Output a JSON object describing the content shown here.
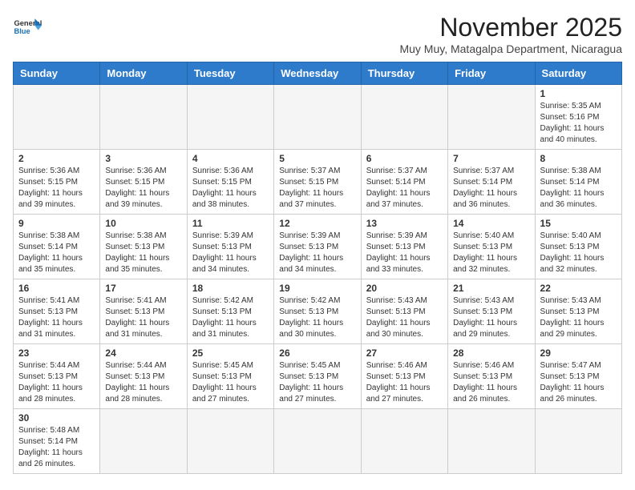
{
  "header": {
    "logo_general": "General",
    "logo_blue": "Blue",
    "month_title": "November 2025",
    "subtitle": "Muy Muy, Matagalpa Department, Nicaragua"
  },
  "days_of_week": [
    "Sunday",
    "Monday",
    "Tuesday",
    "Wednesday",
    "Thursday",
    "Friday",
    "Saturday"
  ],
  "weeks": [
    [
      {
        "day": "",
        "info": ""
      },
      {
        "day": "",
        "info": ""
      },
      {
        "day": "",
        "info": ""
      },
      {
        "day": "",
        "info": ""
      },
      {
        "day": "",
        "info": ""
      },
      {
        "day": "",
        "info": ""
      },
      {
        "day": "1",
        "info": "Sunrise: 5:35 AM\nSunset: 5:16 PM\nDaylight: 11 hours\nand 40 minutes."
      }
    ],
    [
      {
        "day": "2",
        "info": "Sunrise: 5:36 AM\nSunset: 5:15 PM\nDaylight: 11 hours\nand 39 minutes."
      },
      {
        "day": "3",
        "info": "Sunrise: 5:36 AM\nSunset: 5:15 PM\nDaylight: 11 hours\nand 39 minutes."
      },
      {
        "day": "4",
        "info": "Sunrise: 5:36 AM\nSunset: 5:15 PM\nDaylight: 11 hours\nand 38 minutes."
      },
      {
        "day": "5",
        "info": "Sunrise: 5:37 AM\nSunset: 5:15 PM\nDaylight: 11 hours\nand 37 minutes."
      },
      {
        "day": "6",
        "info": "Sunrise: 5:37 AM\nSunset: 5:14 PM\nDaylight: 11 hours\nand 37 minutes."
      },
      {
        "day": "7",
        "info": "Sunrise: 5:37 AM\nSunset: 5:14 PM\nDaylight: 11 hours\nand 36 minutes."
      },
      {
        "day": "8",
        "info": "Sunrise: 5:38 AM\nSunset: 5:14 PM\nDaylight: 11 hours\nand 36 minutes."
      }
    ],
    [
      {
        "day": "9",
        "info": "Sunrise: 5:38 AM\nSunset: 5:14 PM\nDaylight: 11 hours\nand 35 minutes."
      },
      {
        "day": "10",
        "info": "Sunrise: 5:38 AM\nSunset: 5:13 PM\nDaylight: 11 hours\nand 35 minutes."
      },
      {
        "day": "11",
        "info": "Sunrise: 5:39 AM\nSunset: 5:13 PM\nDaylight: 11 hours\nand 34 minutes."
      },
      {
        "day": "12",
        "info": "Sunrise: 5:39 AM\nSunset: 5:13 PM\nDaylight: 11 hours\nand 34 minutes."
      },
      {
        "day": "13",
        "info": "Sunrise: 5:39 AM\nSunset: 5:13 PM\nDaylight: 11 hours\nand 33 minutes."
      },
      {
        "day": "14",
        "info": "Sunrise: 5:40 AM\nSunset: 5:13 PM\nDaylight: 11 hours\nand 32 minutes."
      },
      {
        "day": "15",
        "info": "Sunrise: 5:40 AM\nSunset: 5:13 PM\nDaylight: 11 hours\nand 32 minutes."
      }
    ],
    [
      {
        "day": "16",
        "info": "Sunrise: 5:41 AM\nSunset: 5:13 PM\nDaylight: 11 hours\nand 31 minutes."
      },
      {
        "day": "17",
        "info": "Sunrise: 5:41 AM\nSunset: 5:13 PM\nDaylight: 11 hours\nand 31 minutes."
      },
      {
        "day": "18",
        "info": "Sunrise: 5:42 AM\nSunset: 5:13 PM\nDaylight: 11 hours\nand 31 minutes."
      },
      {
        "day": "19",
        "info": "Sunrise: 5:42 AM\nSunset: 5:13 PM\nDaylight: 11 hours\nand 30 minutes."
      },
      {
        "day": "20",
        "info": "Sunrise: 5:43 AM\nSunset: 5:13 PM\nDaylight: 11 hours\nand 30 minutes."
      },
      {
        "day": "21",
        "info": "Sunrise: 5:43 AM\nSunset: 5:13 PM\nDaylight: 11 hours\nand 29 minutes."
      },
      {
        "day": "22",
        "info": "Sunrise: 5:43 AM\nSunset: 5:13 PM\nDaylight: 11 hours\nand 29 minutes."
      }
    ],
    [
      {
        "day": "23",
        "info": "Sunrise: 5:44 AM\nSunset: 5:13 PM\nDaylight: 11 hours\nand 28 minutes."
      },
      {
        "day": "24",
        "info": "Sunrise: 5:44 AM\nSunset: 5:13 PM\nDaylight: 11 hours\nand 28 minutes."
      },
      {
        "day": "25",
        "info": "Sunrise: 5:45 AM\nSunset: 5:13 PM\nDaylight: 11 hours\nand 27 minutes."
      },
      {
        "day": "26",
        "info": "Sunrise: 5:45 AM\nSunset: 5:13 PM\nDaylight: 11 hours\nand 27 minutes."
      },
      {
        "day": "27",
        "info": "Sunrise: 5:46 AM\nSunset: 5:13 PM\nDaylight: 11 hours\nand 27 minutes."
      },
      {
        "day": "28",
        "info": "Sunrise: 5:46 AM\nSunset: 5:13 PM\nDaylight: 11 hours\nand 26 minutes."
      },
      {
        "day": "29",
        "info": "Sunrise: 5:47 AM\nSunset: 5:13 PM\nDaylight: 11 hours\nand 26 minutes."
      }
    ],
    [
      {
        "day": "30",
        "info": "Sunrise: 5:48 AM\nSunset: 5:14 PM\nDaylight: 11 hours\nand 26 minutes."
      },
      {
        "day": "",
        "info": ""
      },
      {
        "day": "",
        "info": ""
      },
      {
        "day": "",
        "info": ""
      },
      {
        "day": "",
        "info": ""
      },
      {
        "day": "",
        "info": ""
      },
      {
        "day": "",
        "info": ""
      }
    ]
  ]
}
